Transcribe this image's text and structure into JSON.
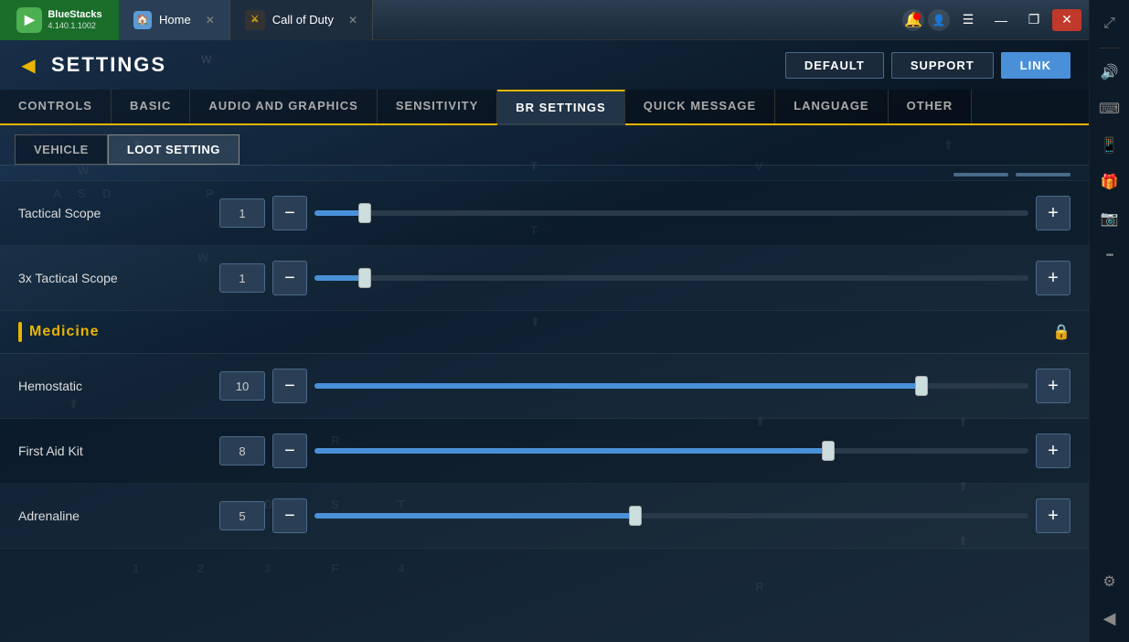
{
  "titlebar": {
    "app_name": "BlueStacks",
    "app_version": "4.140.1.1002",
    "tab_home": "Home",
    "tab_cod": "Call of Duty",
    "minimize": "—",
    "restore": "❐",
    "close": "✕"
  },
  "settings": {
    "title": "SETTINGS",
    "buttons": {
      "default": "DEFAULT",
      "support": "SUPPORT",
      "link": "LINK"
    }
  },
  "nav_tabs": [
    {
      "label": "CONTROLS",
      "active": false
    },
    {
      "label": "BASIC",
      "active": false
    },
    {
      "label": "AUDIO AND GRAPHICS",
      "active": false
    },
    {
      "label": "SENSITIVITY",
      "active": false
    },
    {
      "label": "BR SETTINGS",
      "active": true
    },
    {
      "label": "QUICK MESSAGE",
      "active": false
    },
    {
      "label": "LANGUAGE",
      "active": false
    },
    {
      "label": "OTHER",
      "active": false
    }
  ],
  "sub_tabs": [
    {
      "label": "VEHICLE",
      "active": false
    },
    {
      "label": "LOOT SETTING",
      "active": true
    }
  ],
  "items": [
    {
      "label": "Tactical Scope",
      "value": "1",
      "fill_pct": 7,
      "handle_pct": 7
    },
    {
      "label": "3x Tactical Scope",
      "value": "1",
      "fill_pct": 7,
      "handle_pct": 7
    }
  ],
  "section": {
    "name": "Medicine"
  },
  "medicine_items": [
    {
      "label": "Hemostatic",
      "value": "10",
      "fill_pct": 85,
      "handle_pct": 85
    },
    {
      "label": "First Aid Kit",
      "value": "8",
      "fill_pct": 72,
      "handle_pct": 72
    },
    {
      "label": "Adrenaline",
      "value": "5",
      "fill_pct": 45,
      "handle_pct": 45
    }
  ],
  "sidebar_icons": {
    "notification": "🔔",
    "account": "👤",
    "menu": "☰",
    "expand": "⤢",
    "volume": "🔊",
    "keyboard": "⌨",
    "gamepad": "📱",
    "gift": "🎁",
    "camera": "📷",
    "more": "•••",
    "gear": "⚙",
    "back": "◀"
  }
}
